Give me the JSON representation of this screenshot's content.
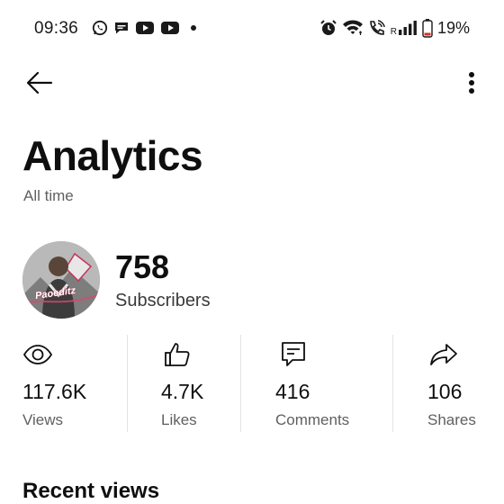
{
  "status_bar": {
    "time": "09:36",
    "left_icons": [
      "whatsapp-icon",
      "chat-icon",
      "youtube-icon",
      "youtube-icon",
      "dot"
    ],
    "right_icons": [
      "alarm-icon",
      "wifi-icon",
      "wifi-call-icon",
      "signal-icon",
      "battery-icon"
    ],
    "roaming": "R",
    "battery": "19%"
  },
  "app_bar": {
    "back_icon": "arrow-left-icon",
    "menu_icon": "more-vert-icon"
  },
  "header": {
    "title": "Analytics",
    "subtitle": "All time"
  },
  "channel": {
    "avatar_text": "Paoeditz",
    "subscriber_count": "758",
    "subscriber_label": "Subscribers"
  },
  "stats": [
    {
      "icon": "eye-icon",
      "value": "117.6K",
      "label": "Views"
    },
    {
      "icon": "thumbs-up-icon",
      "value": "4.7K",
      "label": "Likes"
    },
    {
      "icon": "comment-icon",
      "value": "416",
      "label": "Comments"
    },
    {
      "icon": "share-icon",
      "value": "106",
      "label": "Shares"
    }
  ],
  "sections": {
    "recent_views_title": "Recent views"
  },
  "colors": {
    "text_primary": "#0f0f0f",
    "text_secondary": "#606060",
    "divider": "#e3e3e3",
    "background": "#ffffff"
  }
}
